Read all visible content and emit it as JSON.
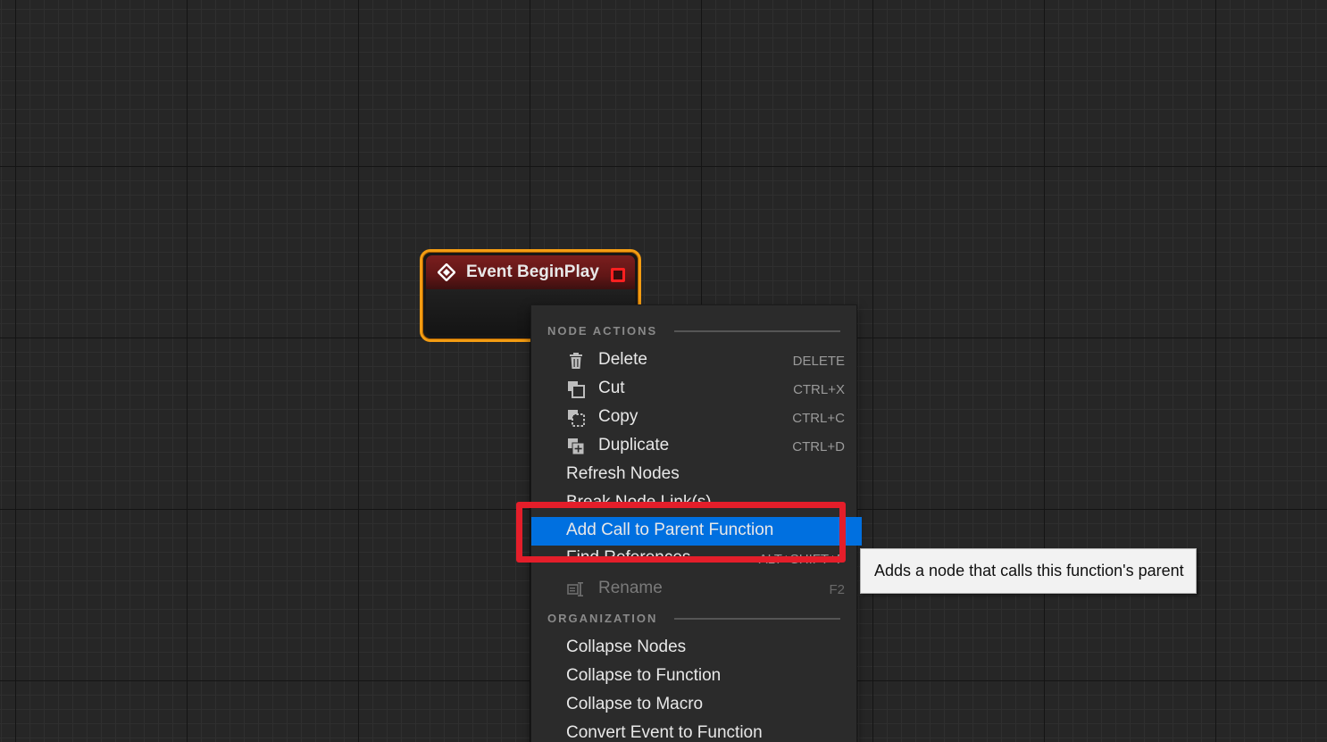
{
  "node": {
    "title": "Event BeginPlay",
    "icon": "event-diamond-icon",
    "header_color": "#7a1e1e",
    "selection_color": "#f39c12"
  },
  "menu": {
    "sections": {
      "node_actions": "NODE ACTIONS",
      "organization": "ORGANIZATION"
    },
    "items": [
      {
        "label": "Delete",
        "shortcut": "DELETE",
        "icon": "trash-icon"
      },
      {
        "label": "Cut",
        "shortcut": "CTRL+X",
        "icon": "cut-icon"
      },
      {
        "label": "Copy",
        "shortcut": "CTRL+C",
        "icon": "copy-icon"
      },
      {
        "label": "Duplicate",
        "shortcut": "CTRL+D",
        "icon": "duplicate-icon"
      },
      {
        "label": "Refresh Nodes"
      },
      {
        "label": "Break Node Link(s)"
      },
      {
        "label": "Add Call to Parent Function",
        "highlighted": true
      },
      {
        "label": "Find References",
        "shortcut": "ALT+SHIFT+F"
      },
      {
        "label": "Rename",
        "shortcut": "F2",
        "icon": "rename-icon",
        "disabled": true
      },
      {
        "label": "Collapse Nodes"
      },
      {
        "label": "Collapse to Function"
      },
      {
        "label": "Collapse to Macro"
      },
      {
        "label": "Convert Event to Function"
      }
    ],
    "highlight_color": "#0070e0"
  },
  "tooltip": {
    "text": "Adds a node that calls this function's parent"
  },
  "annotation_color": "#e41e2a"
}
